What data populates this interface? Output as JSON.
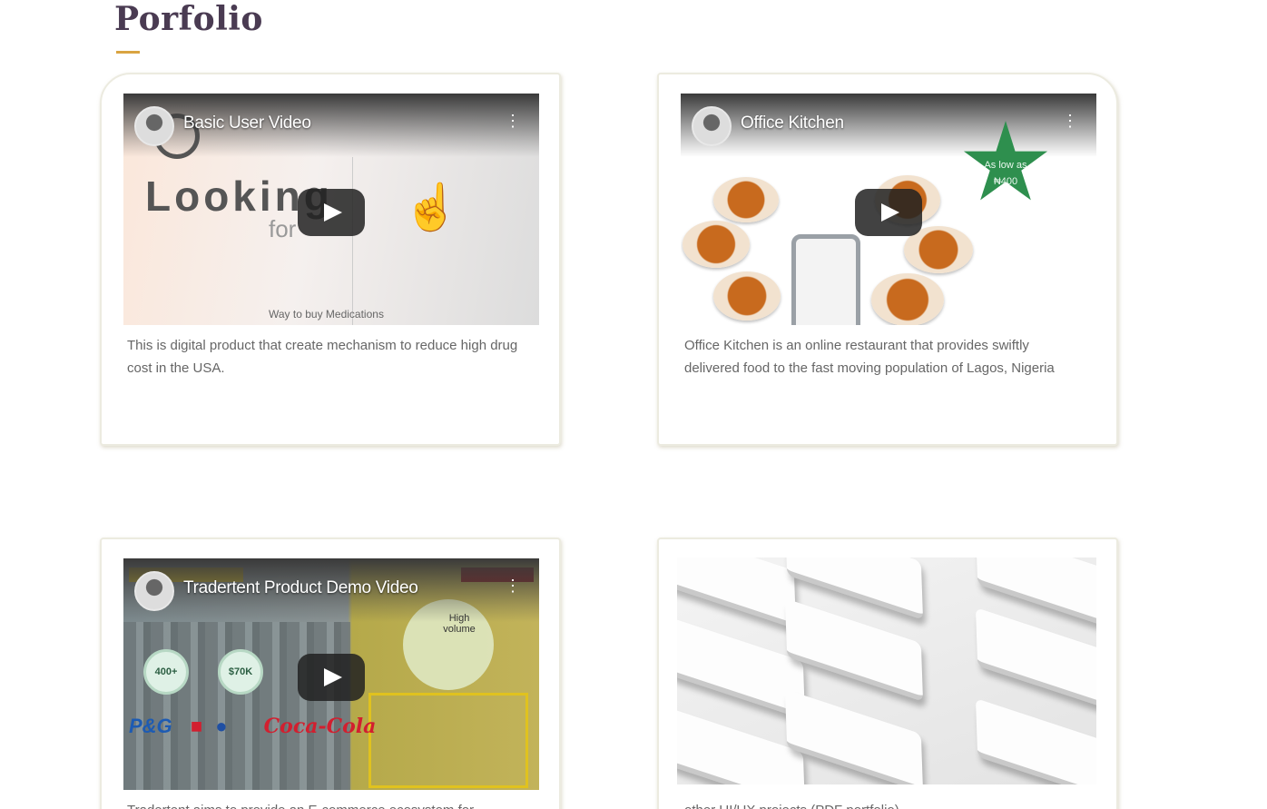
{
  "section": {
    "title": "Porfolio",
    "accent_color": "#d9a441"
  },
  "cards": [
    {
      "video_title": "Basic User Video",
      "description": "This is digital product that create mechanism to reduce high drug cost in the USA.",
      "thumb_big_text": "Looking",
      "thumb_small_text": "for",
      "thumb_caption": "Way to buy Medications"
    },
    {
      "video_title": "Office Kitchen",
      "description": "Office Kitchen is an online restaurant that provides swiftly delivered food to the fast moving population of Lagos, Nigeria",
      "star_text": "As low as ₦400"
    },
    {
      "video_title": "Tradertent Product Demo Video",
      "description": "Tradertent aims to provide an E-commerce ecosystem for",
      "badges": [
        "400+",
        "$70K"
      ],
      "bubble_text": "High volume",
      "brand_logos": "P&G Pepsi Coca-Cola"
    },
    {
      "description": "other UI/UX projects (PDF portfolio)"
    }
  ],
  "icons": {
    "play": "play-icon",
    "more": "more-vert-icon"
  }
}
